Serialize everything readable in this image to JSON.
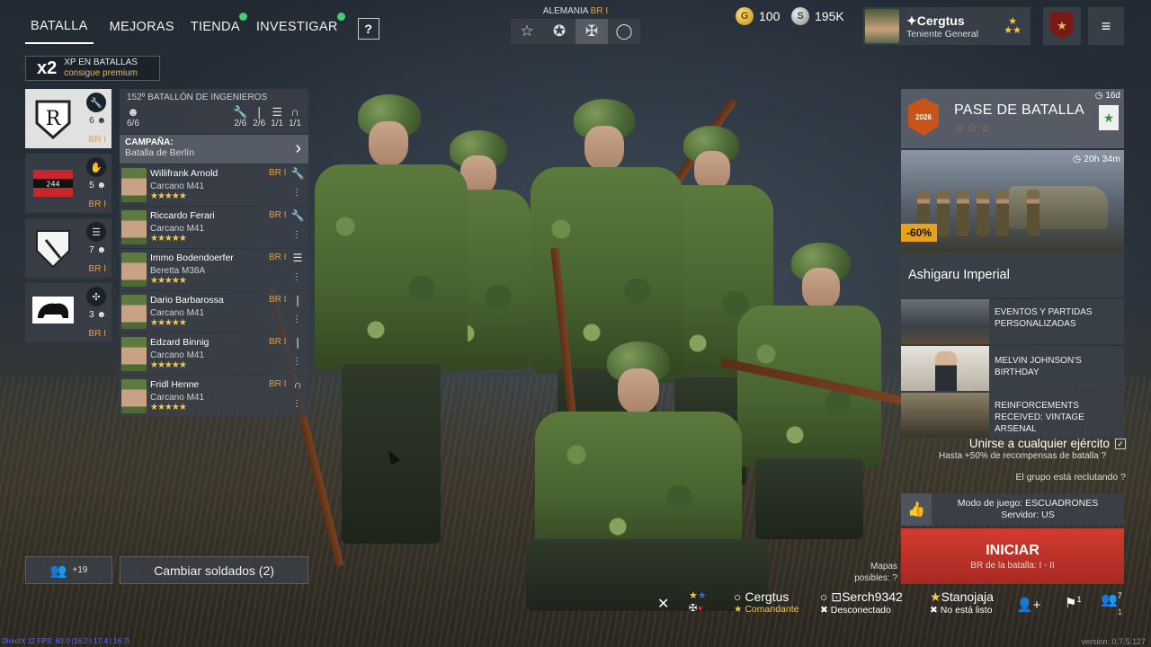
{
  "nav": {
    "tabs": [
      {
        "label": "BATALLA",
        "active": true,
        "dot": false
      },
      {
        "label": "MEJORAS",
        "active": false,
        "dot": false
      },
      {
        "label": "TIENDA",
        "active": false,
        "dot": true
      },
      {
        "label": "INVESTIGAR",
        "active": false,
        "dot": true
      }
    ],
    "help": "?"
  },
  "xp": {
    "mult": "x2",
    "line1": "XP EN BATALLAS",
    "line2": "consigue premium"
  },
  "nation": {
    "name": "ALEMANIA",
    "br": "BR I"
  },
  "currency": {
    "gold": "100",
    "silver": "195K"
  },
  "profile": {
    "name": "Cergtus",
    "rank": "Teniente General"
  },
  "squads": [
    {
      "count": "6",
      "br": "BR I",
      "active": true
    },
    {
      "count": "5",
      "br": "BR I",
      "active": false,
      "label": "244"
    },
    {
      "count": "7",
      "br": "BR I",
      "active": false
    },
    {
      "count": "3",
      "br": "BR I",
      "active": false
    }
  ],
  "detail": {
    "title": "152º BATALLÓN DE INGENIEROS",
    "stats": [
      "6/6",
      "2/6",
      "2/6",
      "1/1",
      "1/1"
    ],
    "campaign_label": "CAMPAÑA:",
    "campaign_value": "Batalla de Berlín"
  },
  "soldiers": [
    {
      "name": "Willifrank Arnold",
      "weapon": "Carcano M41",
      "br": "BR I"
    },
    {
      "name": "Riccardo Ferari",
      "weapon": "Carcano M41",
      "br": "BR I"
    },
    {
      "name": "Immo Bodendoerfer",
      "weapon": "Beretta M38A",
      "br": "BR I"
    },
    {
      "name": "Dario Barbarossa",
      "weapon": "Carcano M41",
      "br": "BR I"
    },
    {
      "name": "Edzard Binnig",
      "weapon": "Carcano M41",
      "br": "BR I"
    },
    {
      "name": "Fridl Henne",
      "weapon": "Carcano M41",
      "br": "BR I"
    }
  ],
  "stars": "★★★★★",
  "friends": {
    "count": "+19"
  },
  "change_soldiers": "Cambiar soldados (2)",
  "battlepass": {
    "title": "PASE DE BATALLA",
    "stars": "☆☆☆",
    "time": "16d",
    "badge": "2026"
  },
  "promo": {
    "time": "20h 34m",
    "discount": "-60%",
    "title": "Ashigaru Imperial"
  },
  "events": [
    {
      "text": "EVENTOS Y PARTIDAS PERSONALIZADAS"
    },
    {
      "text": "MELVIN JOHNSON'S BIRTHDAY"
    },
    {
      "text": "REINFORCEMENTS RECEIVED: VINTAGE ARSENAL"
    }
  ],
  "join": {
    "label": "Unirse a cualquier ejército",
    "sub": "Hasta +50% de recompensas de batalla",
    "recruit": "El grupo está reclutando"
  },
  "mode": {
    "line1": "Modo de juego: ESCUADRONES",
    "line2": "Servidor: US"
  },
  "maps": {
    "line1": "Mapas",
    "line2": "posibles:"
  },
  "start": {
    "label": "INICIAR",
    "sub": "BR de la batalla: I - II"
  },
  "party": [
    {
      "name": "Cergtus",
      "status": "Comandante"
    },
    {
      "name": "Serch9342",
      "status": "Desconectado"
    },
    {
      "name": "Stanojaja",
      "status": "No está listo"
    }
  ],
  "counts": {
    "flag": "1",
    "people": "7",
    "people_sub": "1"
  },
  "dev": "DirectX 12 FPS: 60.0 (16.2 | 17.4 | 16.7)",
  "version": "version: 0.7.5.127"
}
